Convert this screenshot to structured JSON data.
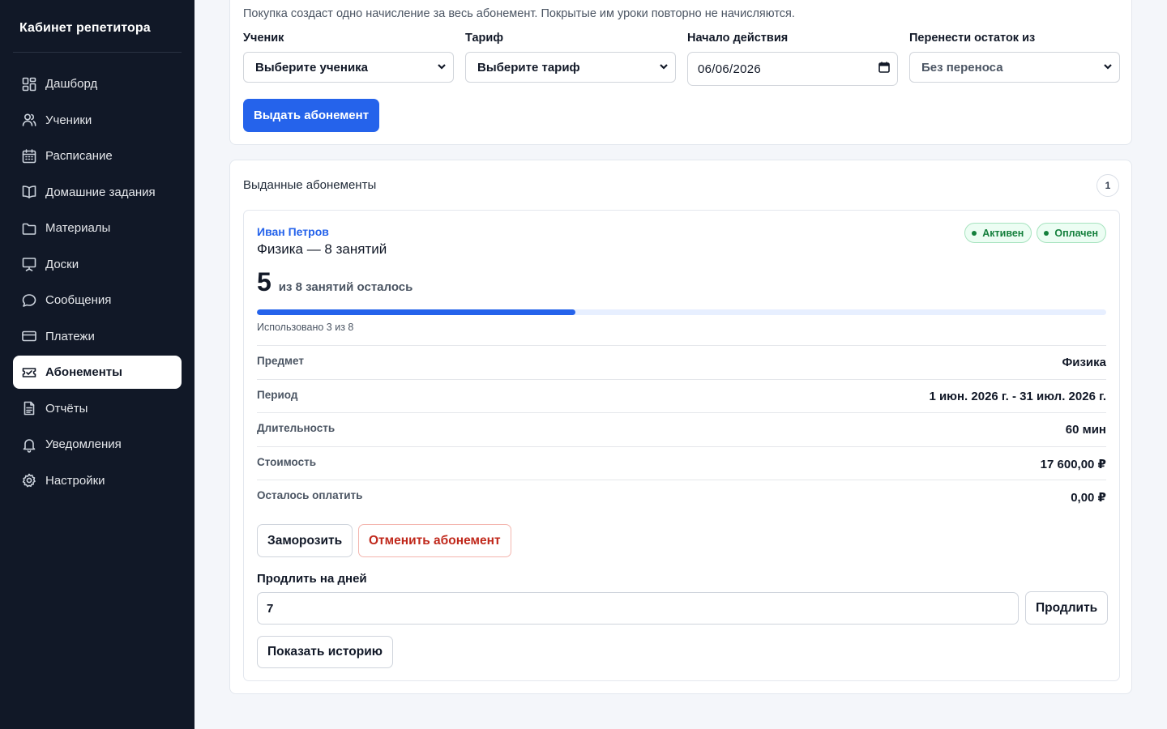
{
  "sidebar": {
    "brand": "Кабинет репетитора",
    "items": [
      {
        "label": "Дашборд",
        "icon": "dashboard-icon"
      },
      {
        "label": "Ученики",
        "icon": "users-icon"
      },
      {
        "label": "Расписание",
        "icon": "calendar-icon"
      },
      {
        "label": "Домашние задания",
        "icon": "book-icon"
      },
      {
        "label": "Материалы",
        "icon": "folder-icon"
      },
      {
        "label": "Доски",
        "icon": "board-icon"
      },
      {
        "label": "Сообщения",
        "icon": "chat-icon"
      },
      {
        "label": "Платежи",
        "icon": "card-icon"
      },
      {
        "label": "Абонементы",
        "icon": "ticket-icon",
        "active": true
      },
      {
        "label": "Отчёты",
        "icon": "report-icon"
      },
      {
        "label": "Уведомления",
        "icon": "bell-icon"
      },
      {
        "label": "Настройки",
        "icon": "gear-icon"
      }
    ]
  },
  "issue_form": {
    "note": "Покупка создаст одно начисление за весь абонемент. Покрытые им уроки повторно не начисляются.",
    "student": {
      "label": "Ученик",
      "value": "Выберите ученика"
    },
    "tariff": {
      "label": "Тариф",
      "value": "Выберите тариф"
    },
    "start": {
      "label": "Начало действия",
      "value": "06/06/2026"
    },
    "carryover": {
      "label": "Перенести остаток из",
      "value": "Без переноса"
    },
    "submit_label": "Выдать абонемент"
  },
  "issued": {
    "title": "Выданные абонементы",
    "count": "1",
    "subscription": {
      "student": "Иван Петров",
      "plan": "Физика — 8 занятий",
      "badges": {
        "status": "Активен",
        "payment": "Оплачен"
      },
      "remaining": "5",
      "remaining_text": "из 8 занятий осталось",
      "progress_used_fraction": 0.375,
      "used_text": "Использовано 3 из 8",
      "details": [
        {
          "key": "Предмет",
          "value": "Физика"
        },
        {
          "key": "Период",
          "value": "1 июн. 2026 г. - 31 июл. 2026 г."
        },
        {
          "key": "Длительность",
          "value": "60 мин"
        },
        {
          "key": "Стоимость",
          "value": "17 600,00 ₽"
        },
        {
          "key": "Осталось оплатить",
          "value": "0,00 ₽"
        }
      ],
      "freeze_label": "Заморозить",
      "cancel_label": "Отменить абонемент",
      "extend_label": "Продлить на дней",
      "extend_value": "7",
      "extend_button": "Продлить",
      "history_button": "Показать историю"
    }
  },
  "colors": {
    "accent": "#2563eb",
    "sidebar_bg": "#111827",
    "success": "#15803d",
    "danger": "#c0281b"
  }
}
